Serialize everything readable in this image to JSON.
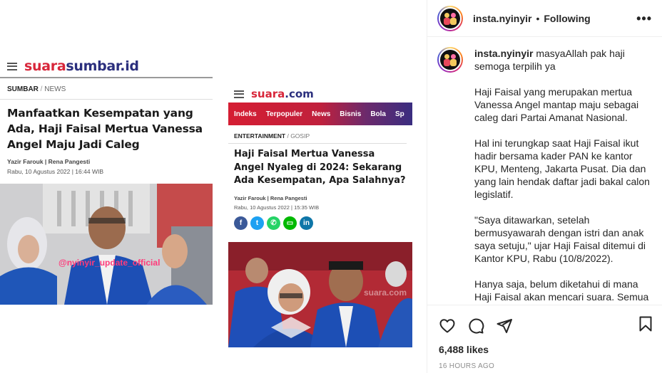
{
  "media": {
    "card1": {
      "logo_red": "suara",
      "logo_blue": "sumbar.id",
      "breadcrumb_section": "SUMBAR",
      "breadcrumb_sep": " / ",
      "breadcrumb_sub": "NEWS",
      "title": "Manfaatkan Kesempatan yang Ada, Haji Faisal Mertua Vanessa Angel Maju Jadi Caleg",
      "author": "Yazir Farouk | Rena Pangesti",
      "date": "Rabu, 10 Agustus 2022 | 16:44 WIB",
      "watermark": "@nyinyir_update_official"
    },
    "card2": {
      "logo_red": "suara",
      "logo_blue": ".com",
      "nav": [
        "Indeks",
        "Terpopuler",
        "News",
        "Bisnis",
        "Bola",
        "Sp"
      ],
      "breadcrumb_section": "ENTERTAINMENT",
      "breadcrumb_sep": " / ",
      "breadcrumb_sub": "GOSIP",
      "title": "Haji Faisal Mertua Vanessa Angel Nyaleg di 2024: Sekarang Ada Kesempatan, Apa Salahnya?",
      "author": "Yazir Farouk | Rena Pangesti",
      "date": "Rabu, 10 Agustus 2022 | 15:35 WIB",
      "share_icons": [
        "facebook-icon",
        "twitter-icon",
        "whatsapp-icon",
        "line-icon",
        "linkedin-icon"
      ],
      "watermark": "suara.com"
    }
  },
  "panel": {
    "header": {
      "username": "insta.nyinyir",
      "dot": "•",
      "following": "Following",
      "more": "•••"
    },
    "caption": {
      "username": "insta.nyinyir",
      "paragraphs": [
        "masyaAllah pak haji semoga terpilih ya",
        "Haji Faisal yang merupakan mertua Vanessa Angel mantap maju sebagai caleg dari Partai Amanat Nasional.",
        "Hal ini terungkap saat Haji Faisal ikut hadir bersama kader PAN ke kantor KPU, Menteng, Jakarta Pusat. Dia dan yang lain hendak daftar jadi bakal calon legislatif.",
        "\"Saya ditawarkan, setelah bermusyawarah dengan istri dan anak saya setuju,\" ujar Haji Faisal ditemui di Kantor KPU, Rabu (10/8/2022).",
        "Hanya saja, belum diketahui di mana Haji Faisal akan mencari suara. Semua"
      ]
    },
    "actions": {
      "icons": [
        "heart-icon",
        "comment-icon",
        "share-icon",
        "bookmark-icon"
      ],
      "likes": "6,488 likes",
      "time_ago": "16 HOURS AGO"
    }
  },
  "colors": {
    "suara_red": "#d8263a",
    "suara_blue": "#2b2f7d",
    "ig_text": "#262626",
    "ig_gray": "#8e8e8e"
  }
}
